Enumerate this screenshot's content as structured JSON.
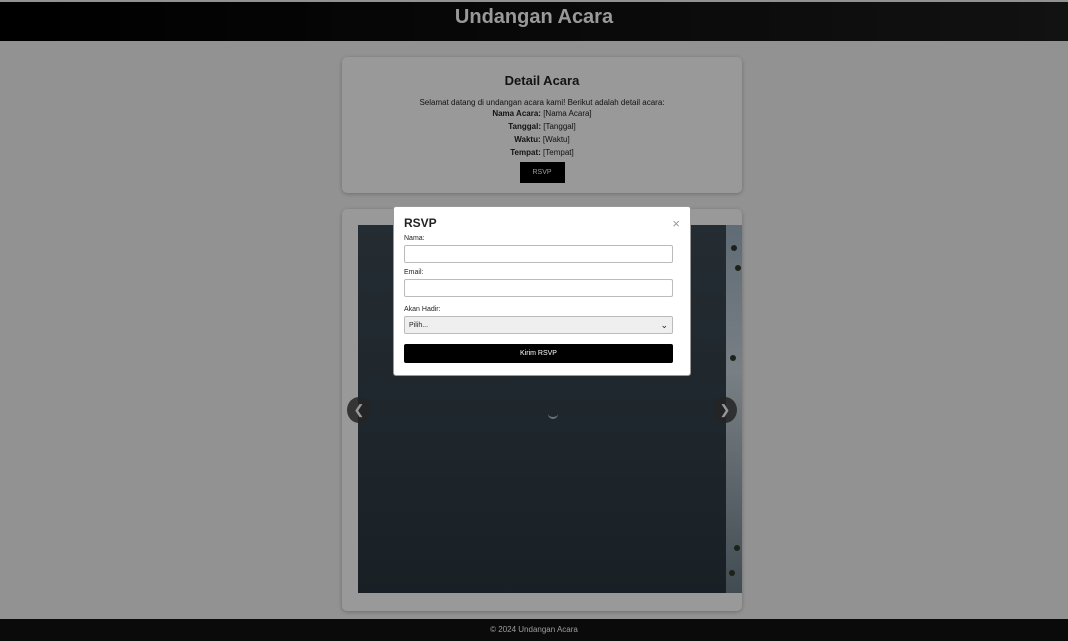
{
  "header": {
    "title": "Undangan Acara"
  },
  "details": {
    "heading": "Detail Acara",
    "intro": "Selamat datang di undangan acara kami! Berikut adalah detail acara:",
    "rows": [
      {
        "label": "Nama Acara:",
        "value": "[Nama Acara]"
      },
      {
        "label": "Tanggal:",
        "value": "[Tanggal]"
      },
      {
        "label": "Waktu:",
        "value": "[Waktu]"
      },
      {
        "label": "Tempat:",
        "value": "[Tempat]"
      }
    ],
    "rsvp_label": "RSVP"
  },
  "gallery": {
    "prev_glyph": "❮",
    "next_glyph": "❯"
  },
  "modal": {
    "title": "RSVP",
    "close_glyph": "×",
    "name_label": "Nama:",
    "name_value": "",
    "email_label": "Email:",
    "email_value": "",
    "attend_label": "Akan Hadir:",
    "attend_selected": "Pilih...",
    "submit_label": "Kirim RSVP"
  },
  "footer": {
    "text": "© 2024 Undangan Acara"
  },
  "icons": {
    "prev": "chevron-left-icon",
    "next": "chevron-right-icon",
    "close": "close-icon",
    "dropdown": "chevron-down-icon"
  },
  "colors": {
    "header_bg": "#000000",
    "button_bg": "#000000",
    "footer_bg": "#111111",
    "overlay": "#000000"
  }
}
